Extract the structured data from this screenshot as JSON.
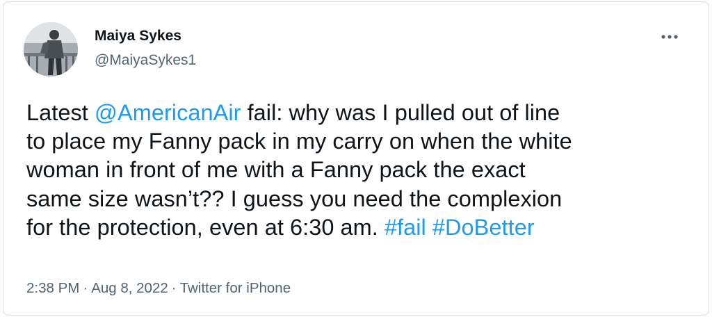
{
  "user": {
    "display_name": "Maiya Sykes",
    "handle": "@MaiyaSykes1"
  },
  "tweet": {
    "line1": {
      "prefix": "Latest ",
      "mention": "@AmericanAir",
      "suffix": " fail: why was I pulled out of line"
    },
    "line2": "to place my Fanny pack in my carry on when the white",
    "line3": "woman in front of me with a Fanny pack the exact",
    "line4": "same size wasn’t?? I guess you need the complexion",
    "line5": {
      "text": "for the protection, even at 6:30 am. ",
      "hashtag1": "#fail",
      "space": " ",
      "hashtag2": "#DoBetter"
    }
  },
  "meta": {
    "time": "2:38 PM",
    "separator": "·",
    "date": "Aug 8, 2022",
    "source": "Twitter for iPhone"
  },
  "icons": {
    "more": "more-horizontal-icon",
    "avatar": "profile-photo"
  },
  "colors": {
    "link": "#1d9bf0",
    "secondary_text": "#536471",
    "primary_text": "#0f1419"
  }
}
